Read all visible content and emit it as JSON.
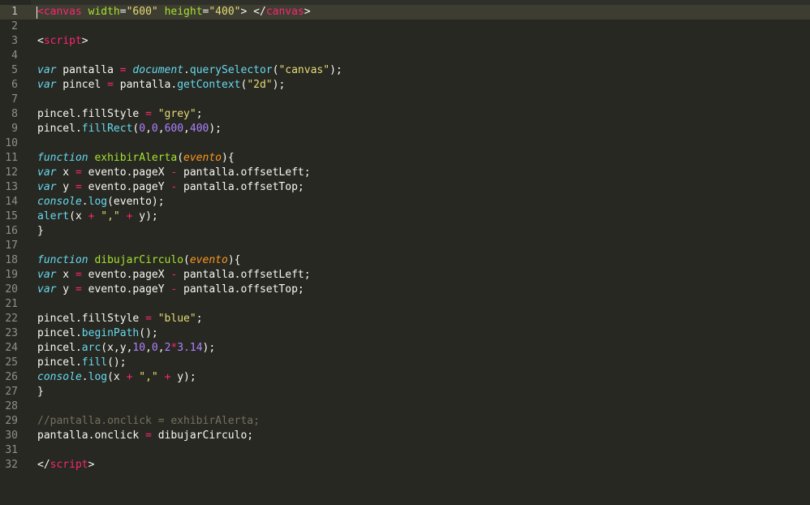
{
  "editor": {
    "theme_colors": {
      "background": "#272822",
      "gutter_text": "#90908a",
      "tag": "#f92672",
      "attribute": "#a6e22e",
      "string": "#e6db74",
      "keyword": "#66d9ef",
      "parameter": "#fd971f",
      "number": "#ae81ff",
      "comment": "#75715e",
      "text": "#f8f8f2"
    },
    "current_line": 1,
    "lines": [
      {
        "n": "1",
        "tokens": [
          {
            "t": "<",
            "c": "tag"
          },
          {
            "t": "canvas",
            "c": "tag"
          },
          {
            "t": " ",
            "c": "plain"
          },
          {
            "t": "width",
            "c": "attr"
          },
          {
            "t": "=",
            "c": "plain"
          },
          {
            "t": "\"600\"",
            "c": "str"
          },
          {
            "t": " ",
            "c": "plain"
          },
          {
            "t": "height",
            "c": "attr"
          },
          {
            "t": "=",
            "c": "plain"
          },
          {
            "t": "\"400\"",
            "c": "str"
          },
          {
            "t": "> </",
            "c": "plain"
          },
          {
            "t": "canvas",
            "c": "tag"
          },
          {
            "t": ">",
            "c": "plain"
          }
        ]
      },
      {
        "n": "2",
        "tokens": []
      },
      {
        "n": "3",
        "tokens": [
          {
            "t": "<",
            "c": "plain"
          },
          {
            "t": "script",
            "c": "tag"
          },
          {
            "t": ">",
            "c": "plain"
          }
        ]
      },
      {
        "n": "4",
        "tokens": []
      },
      {
        "n": "5",
        "tokens": [
          {
            "t": "var",
            "c": "kw"
          },
          {
            "t": " pantalla ",
            "c": "plain"
          },
          {
            "t": "=",
            "c": "op"
          },
          {
            "t": " ",
            "c": "plain"
          },
          {
            "t": "document",
            "c": "cls"
          },
          {
            "t": ".",
            "c": "plain"
          },
          {
            "t": "querySelector",
            "c": "fn"
          },
          {
            "t": "(",
            "c": "plain"
          },
          {
            "t": "\"canvas\"",
            "c": "str"
          },
          {
            "t": ");",
            "c": "plain"
          }
        ]
      },
      {
        "n": "6",
        "tokens": [
          {
            "t": "var",
            "c": "kw"
          },
          {
            "t": " pincel ",
            "c": "plain"
          },
          {
            "t": "=",
            "c": "op"
          },
          {
            "t": " pantalla.",
            "c": "plain"
          },
          {
            "t": "getContext",
            "c": "fn"
          },
          {
            "t": "(",
            "c": "plain"
          },
          {
            "t": "\"2d\"",
            "c": "str"
          },
          {
            "t": ");",
            "c": "plain"
          }
        ]
      },
      {
        "n": "7",
        "tokens": []
      },
      {
        "n": "8",
        "tokens": [
          {
            "t": "pincel.fillStyle ",
            "c": "plain"
          },
          {
            "t": "=",
            "c": "op"
          },
          {
            "t": " ",
            "c": "plain"
          },
          {
            "t": "\"grey\"",
            "c": "str"
          },
          {
            "t": ";",
            "c": "plain"
          }
        ]
      },
      {
        "n": "9",
        "tokens": [
          {
            "t": "pincel.",
            "c": "plain"
          },
          {
            "t": "fillRect",
            "c": "fn"
          },
          {
            "t": "(",
            "c": "plain"
          },
          {
            "t": "0",
            "c": "num"
          },
          {
            "t": ",",
            "c": "plain"
          },
          {
            "t": "0",
            "c": "num"
          },
          {
            "t": ",",
            "c": "plain"
          },
          {
            "t": "600",
            "c": "num"
          },
          {
            "t": ",",
            "c": "plain"
          },
          {
            "t": "400",
            "c": "num"
          },
          {
            "t": ");",
            "c": "plain"
          }
        ]
      },
      {
        "n": "10",
        "tokens": []
      },
      {
        "n": "11",
        "tokens": [
          {
            "t": "function",
            "c": "kw"
          },
          {
            "t": " ",
            "c": "plain"
          },
          {
            "t": "exhibirAlerta",
            "c": "def"
          },
          {
            "t": "(",
            "c": "plain"
          },
          {
            "t": "evento",
            "c": "param"
          },
          {
            "t": "){",
            "c": "plain"
          }
        ]
      },
      {
        "n": "12",
        "tokens": [
          {
            "t": "var",
            "c": "kw"
          },
          {
            "t": " x ",
            "c": "plain"
          },
          {
            "t": "=",
            "c": "op"
          },
          {
            "t": " evento.pageX ",
            "c": "plain"
          },
          {
            "t": "-",
            "c": "op"
          },
          {
            "t": " pantalla.offsetLeft;",
            "c": "plain"
          }
        ]
      },
      {
        "n": "13",
        "tokens": [
          {
            "t": "var",
            "c": "kw"
          },
          {
            "t": " y ",
            "c": "plain"
          },
          {
            "t": "=",
            "c": "op"
          },
          {
            "t": " evento.pageY ",
            "c": "plain"
          },
          {
            "t": "-",
            "c": "op"
          },
          {
            "t": " pantalla.offsetTop;",
            "c": "plain"
          }
        ]
      },
      {
        "n": "14",
        "tokens": [
          {
            "t": "console",
            "c": "cls"
          },
          {
            "t": ".",
            "c": "plain"
          },
          {
            "t": "log",
            "c": "fn"
          },
          {
            "t": "(evento);",
            "c": "plain"
          }
        ]
      },
      {
        "n": "15",
        "tokens": [
          {
            "t": "alert",
            "c": "fn"
          },
          {
            "t": "(x ",
            "c": "plain"
          },
          {
            "t": "+",
            "c": "op"
          },
          {
            "t": " ",
            "c": "plain"
          },
          {
            "t": "\",\"",
            "c": "str"
          },
          {
            "t": " ",
            "c": "plain"
          },
          {
            "t": "+",
            "c": "op"
          },
          {
            "t": " y);",
            "c": "plain"
          }
        ]
      },
      {
        "n": "16",
        "tokens": [
          {
            "t": "}",
            "c": "plain"
          }
        ]
      },
      {
        "n": "17",
        "tokens": []
      },
      {
        "n": "18",
        "tokens": [
          {
            "t": "function",
            "c": "kw"
          },
          {
            "t": " ",
            "c": "plain"
          },
          {
            "t": "dibujarCirculo",
            "c": "def"
          },
          {
            "t": "(",
            "c": "plain"
          },
          {
            "t": "evento",
            "c": "param"
          },
          {
            "t": "){",
            "c": "plain"
          }
        ]
      },
      {
        "n": "19",
        "tokens": [
          {
            "t": "var",
            "c": "kw"
          },
          {
            "t": " x ",
            "c": "plain"
          },
          {
            "t": "=",
            "c": "op"
          },
          {
            "t": " evento.pageX ",
            "c": "plain"
          },
          {
            "t": "-",
            "c": "op"
          },
          {
            "t": " pantalla.offsetLeft;",
            "c": "plain"
          }
        ]
      },
      {
        "n": "20",
        "tokens": [
          {
            "t": "var",
            "c": "kw"
          },
          {
            "t": " y ",
            "c": "plain"
          },
          {
            "t": "=",
            "c": "op"
          },
          {
            "t": " evento.pageY ",
            "c": "plain"
          },
          {
            "t": "-",
            "c": "op"
          },
          {
            "t": " pantalla.offsetTop;",
            "c": "plain"
          }
        ]
      },
      {
        "n": "21",
        "tokens": []
      },
      {
        "n": "22",
        "tokens": [
          {
            "t": "pincel.fillStyle ",
            "c": "plain"
          },
          {
            "t": "=",
            "c": "op"
          },
          {
            "t": " ",
            "c": "plain"
          },
          {
            "t": "\"blue\"",
            "c": "str"
          },
          {
            "t": ";",
            "c": "plain"
          }
        ]
      },
      {
        "n": "23",
        "tokens": [
          {
            "t": "pincel.",
            "c": "plain"
          },
          {
            "t": "beginPath",
            "c": "fn"
          },
          {
            "t": "();",
            "c": "plain"
          }
        ]
      },
      {
        "n": "24",
        "tokens": [
          {
            "t": "pincel.",
            "c": "plain"
          },
          {
            "t": "arc",
            "c": "fn"
          },
          {
            "t": "(x,y,",
            "c": "plain"
          },
          {
            "t": "10",
            "c": "num"
          },
          {
            "t": ",",
            "c": "plain"
          },
          {
            "t": "0",
            "c": "num"
          },
          {
            "t": ",",
            "c": "plain"
          },
          {
            "t": "2",
            "c": "num"
          },
          {
            "t": "*",
            "c": "op"
          },
          {
            "t": "3.14",
            "c": "num"
          },
          {
            "t": ");",
            "c": "plain"
          }
        ]
      },
      {
        "n": "25",
        "tokens": [
          {
            "t": "pincel.",
            "c": "plain"
          },
          {
            "t": "fill",
            "c": "fn"
          },
          {
            "t": "();",
            "c": "plain"
          }
        ]
      },
      {
        "n": "26",
        "tokens": [
          {
            "t": "console",
            "c": "cls"
          },
          {
            "t": ".",
            "c": "plain"
          },
          {
            "t": "log",
            "c": "fn"
          },
          {
            "t": "(x ",
            "c": "plain"
          },
          {
            "t": "+",
            "c": "op"
          },
          {
            "t": " ",
            "c": "plain"
          },
          {
            "t": "\",\"",
            "c": "str"
          },
          {
            "t": " ",
            "c": "plain"
          },
          {
            "t": "+",
            "c": "op"
          },
          {
            "t": " y);",
            "c": "plain"
          }
        ]
      },
      {
        "n": "27",
        "tokens": [
          {
            "t": "}",
            "c": "plain"
          }
        ]
      },
      {
        "n": "28",
        "tokens": []
      },
      {
        "n": "29",
        "tokens": [
          {
            "t": "//pantalla.onclick = exhibirAlerta;",
            "c": "cmt"
          }
        ]
      },
      {
        "n": "30",
        "tokens": [
          {
            "t": "pantalla.onclick ",
            "c": "plain"
          },
          {
            "t": "=",
            "c": "op"
          },
          {
            "t": " dibujarCirculo;",
            "c": "plain"
          }
        ]
      },
      {
        "n": "31",
        "tokens": []
      },
      {
        "n": "32",
        "tokens": [
          {
            "t": "</",
            "c": "plain"
          },
          {
            "t": "script",
            "c": "tag"
          },
          {
            "t": ">",
            "c": "plain"
          }
        ]
      }
    ]
  }
}
